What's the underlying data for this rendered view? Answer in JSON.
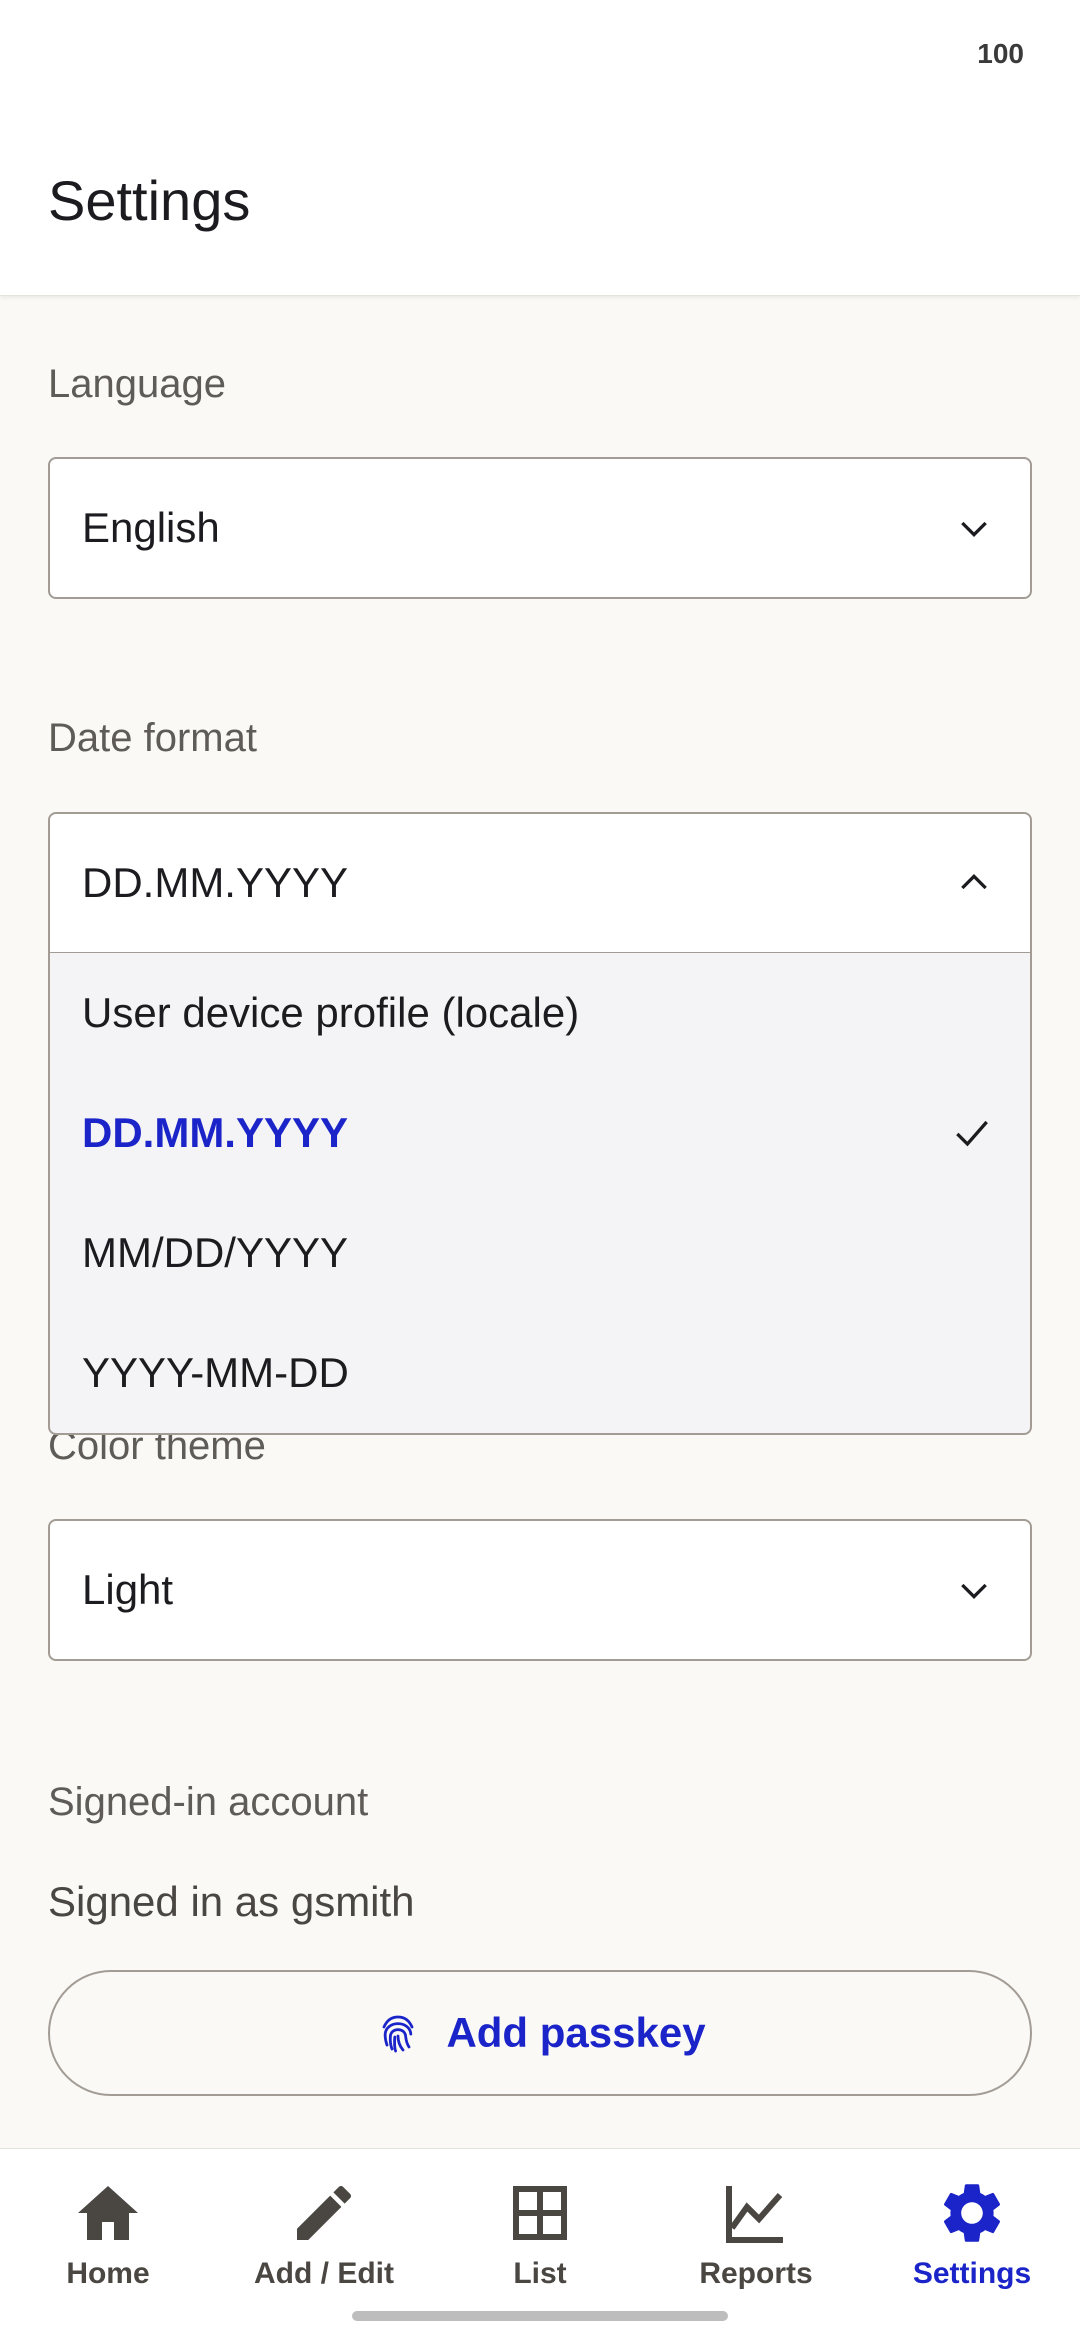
{
  "status_bar": {
    "battery": "100"
  },
  "header": {
    "title": "Settings"
  },
  "language": {
    "label": "Language",
    "value": "English"
  },
  "date_format": {
    "label": "Date format",
    "value": "DD.MM.YYYY",
    "options": [
      {
        "label": "User device profile (locale)"
      },
      {
        "label": "DD.MM.YYYY"
      },
      {
        "label": "MM/DD/YYYY"
      },
      {
        "label": "YYYY-MM-DD"
      }
    ]
  },
  "color_theme": {
    "label": "Color theme",
    "value": "Light"
  },
  "account": {
    "section_label": "Signed-in account",
    "signed_in_text": "Signed in as gsmith",
    "passkey_button": "Add passkey"
  },
  "nav": {
    "items": [
      {
        "label": "Home",
        "icon": "home-icon"
      },
      {
        "label": "Add / Edit",
        "icon": "pencil-icon"
      },
      {
        "label": "List",
        "icon": "grid-icon"
      },
      {
        "label": "Reports",
        "icon": "chart-icon"
      },
      {
        "label": "Settings",
        "icon": "gear-icon"
      }
    ],
    "active": "Settings"
  },
  "colors": {
    "accent": "#1a24c8",
    "background": "#faf9f6",
    "border": "#a39c95",
    "menu_background": "#f4f3f5"
  }
}
